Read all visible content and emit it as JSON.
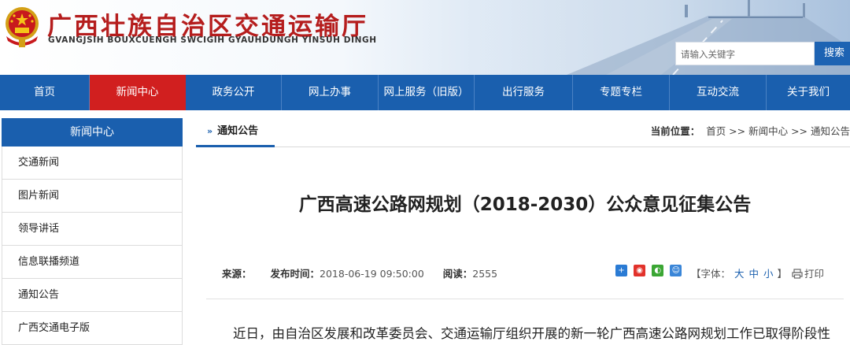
{
  "header": {
    "title": "广西壮族自治区交通运输厅",
    "subtitle": "GVANGJSIH BOUXCUENGH SWCIGIH GYAUHDUNGH YINSUH DINGH",
    "search_placeholder": "请输入关键字",
    "search_button": "搜索"
  },
  "nav": {
    "items": [
      {
        "label": "首页"
      },
      {
        "label": "新闻中心"
      },
      {
        "label": "政务公开"
      },
      {
        "label": "网上办事"
      },
      {
        "label": "网上服务（旧版）"
      },
      {
        "label": "出行服务"
      },
      {
        "label": "专题专栏"
      },
      {
        "label": "互动交流"
      },
      {
        "label": "关于我们"
      }
    ],
    "active_index": 1
  },
  "sidebar": {
    "heading": "新闻中心",
    "items": [
      {
        "label": "交通新闻"
      },
      {
        "label": "图片新闻"
      },
      {
        "label": "领导讲话"
      },
      {
        "label": "信息联播频道"
      },
      {
        "label": "通知公告"
      },
      {
        "label": "广西交通电子版"
      }
    ]
  },
  "main": {
    "tab_label": "通知公告",
    "breadcrumb_label": "当前位置：",
    "breadcrumb": "首页 >> 新闻中心 >> 通知公告",
    "article_title": "广西高速公路网规划（2018-2030）公众意见征集公告",
    "meta": {
      "source_label": "来源：",
      "source_value": "",
      "publish_label": "发布时间：",
      "publish_value": "2018-06-19 09:50:00",
      "reads_label": "阅读：",
      "reads_value": "2555"
    },
    "font_label": "【字体：",
    "font_large": "大",
    "font_medium": "中",
    "font_small": "小",
    "font_close": "】",
    "print_label": "打印",
    "body_first_line": "近日，由自治区发展和改革委员会、交通运输厅组织开展的新一轮广西高速公路网规划工作已取得阶段性"
  },
  "colors": {
    "primary_blue": "#1a5fae",
    "active_red": "#d11f1f",
    "title_red": "#b51d1d"
  }
}
